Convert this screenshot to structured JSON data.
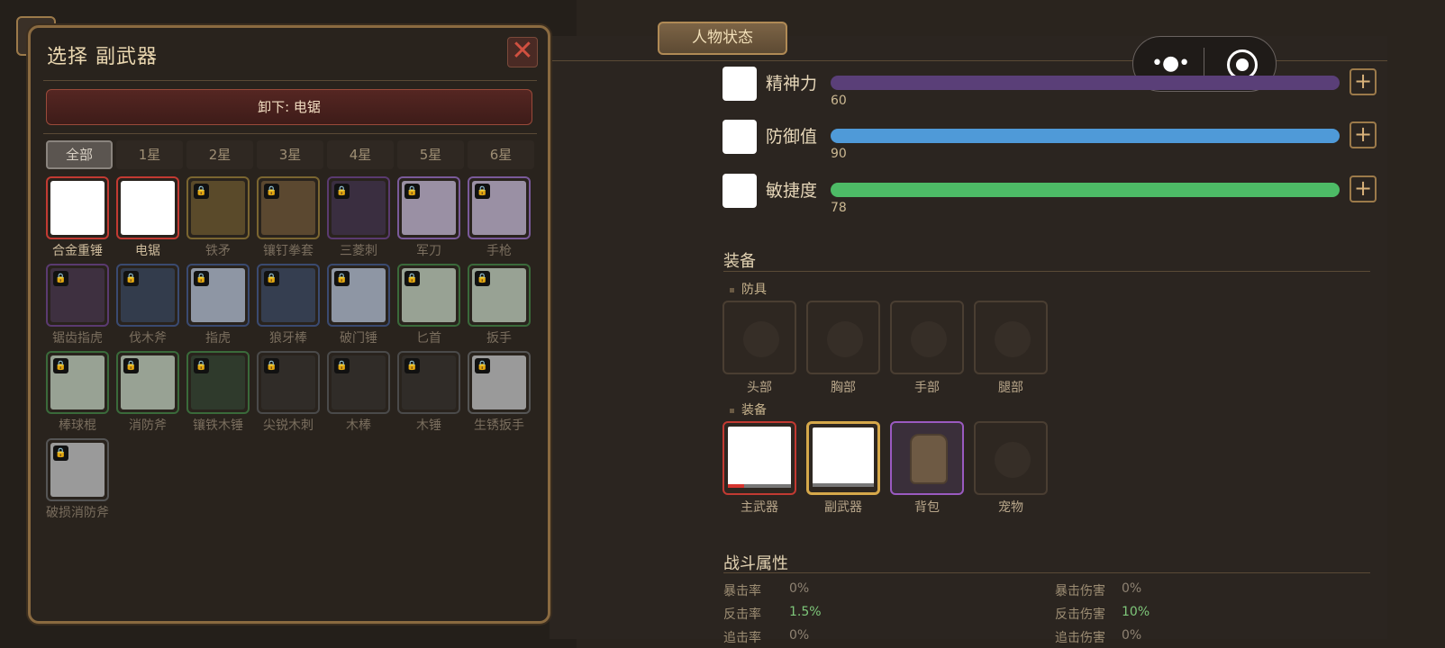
{
  "screen_title": "人物状态",
  "stats": [
    {
      "name": "精神力",
      "value": "60",
      "color": "#6a4a8a"
    },
    {
      "name": "防御值",
      "value": "90",
      "color": "#4f9ad8"
    },
    {
      "name": "敏捷度",
      "value": "78",
      "color": "#4dbb66"
    }
  ],
  "equipment": {
    "title": "装备",
    "armor_title": "防具",
    "armor_slots": [
      "头部",
      "胸部",
      "手部",
      "腿部"
    ],
    "gear_title": "装备",
    "gear_slots": [
      "主武器",
      "副武器",
      "背包",
      "宠物"
    ]
  },
  "combat": {
    "title": "战斗属性",
    "rows": [
      {
        "l1": "暴击率",
        "v1": "0%",
        "l2": "暴击伤害",
        "v2": "0%"
      },
      {
        "l1": "反击率",
        "v1": "1.5%",
        "l2": "反击伤害",
        "v2": "10%"
      },
      {
        "l1": "追击率",
        "v1": "0%",
        "l2": "追击伤害",
        "v2": "0%"
      }
    ]
  },
  "modal": {
    "title": "选择 副武器",
    "close": "✕",
    "unequip_label": "卸下: 电锯",
    "tabs": [
      "全部",
      "1星",
      "2星",
      "3星",
      "4星",
      "5星",
      "6星"
    ],
    "items": [
      "合金重锤",
      "电锯",
      "铁矛",
      "镶钉拳套",
      "三菱刺",
      "军刀",
      "手枪",
      "锯齿指虎",
      "伐木斧",
      "指虎",
      "狼牙棒",
      "破门锤",
      "匕首",
      "扳手",
      "棒球棍",
      "消防斧",
      "镶铁木锤",
      "尖锐木刺",
      "木棒",
      "木锤",
      "生锈扳手",
      "破损消防斧"
    ]
  },
  "icons": {
    "lock": "🔒",
    "plus": "+"
  }
}
